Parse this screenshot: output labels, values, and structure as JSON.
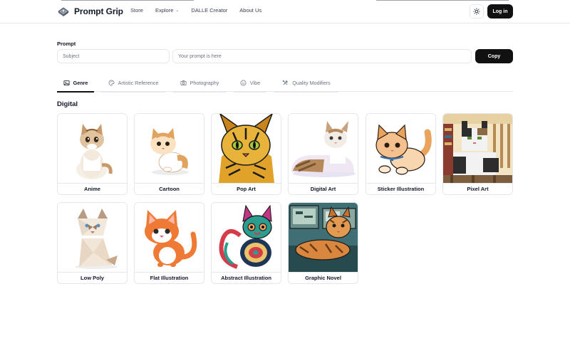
{
  "header": {
    "logo_text": "Prompt Grip",
    "nav": [
      {
        "label": "Store"
      },
      {
        "label": "Explore",
        "has_dropdown": true
      },
      {
        "label": "DALLE Creator"
      },
      {
        "label": "About Us"
      }
    ],
    "login_label": "Log in"
  },
  "prompt": {
    "label": "Prompt",
    "subject_placeholder": "Subject",
    "prompt_placeholder": "Your prompt is here",
    "copy_label": "Copy"
  },
  "tabs": [
    {
      "label": "Genre",
      "icon": "image-icon",
      "active": true
    },
    {
      "label": "Artistic Reference",
      "icon": "palette-icon",
      "active": false
    },
    {
      "label": "Photography",
      "icon": "camera-icon",
      "active": false
    },
    {
      "label": "Vibe",
      "icon": "smile-icon",
      "active": false
    },
    {
      "label": "Quality Modifiers",
      "icon": "tools-icon",
      "active": false
    }
  ],
  "section": {
    "title": "Digital",
    "cards": [
      {
        "label": "Anime"
      },
      {
        "label": "Cartoon"
      },
      {
        "label": "Pop Art"
      },
      {
        "label": "Digital Art"
      },
      {
        "label": "Sticker Illustration"
      },
      {
        "label": "Pixel Art"
      },
      {
        "label": "Low Poly"
      },
      {
        "label": "Flat Illustration"
      },
      {
        "label": "Abstract Illustration"
      },
      {
        "label": "Graphic Novel"
      }
    ]
  },
  "colors": {
    "primary_button": "#111111",
    "border": "#e5e7eb",
    "muted_text": "#6b7280"
  }
}
